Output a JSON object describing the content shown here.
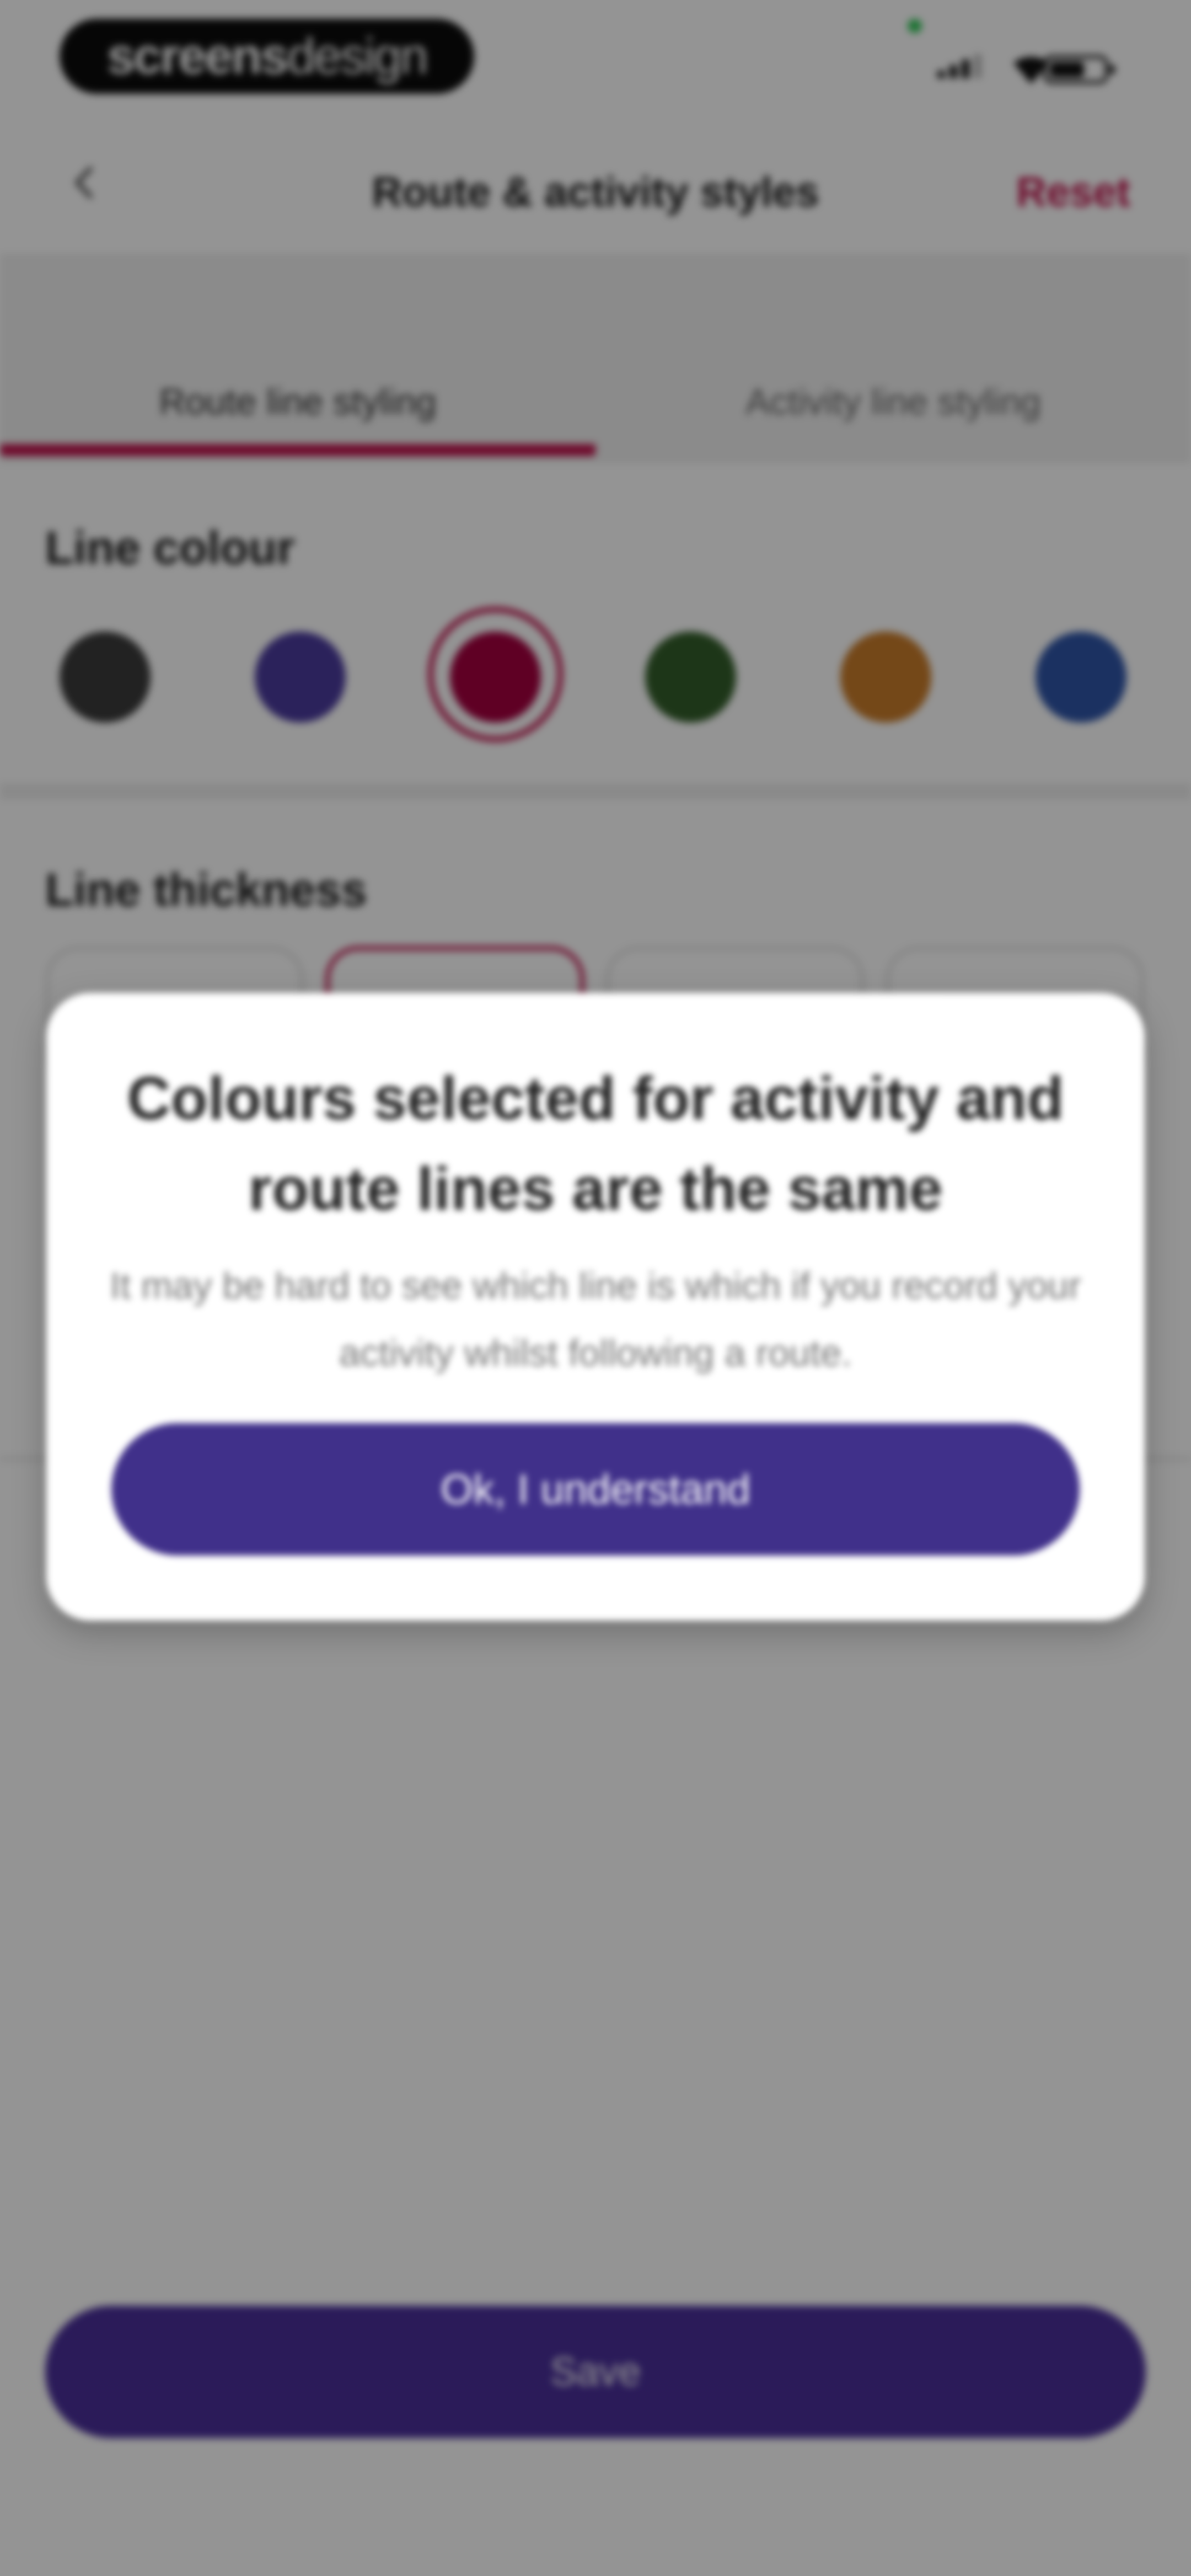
{
  "status_bar": {
    "logo_bold": "screens",
    "logo_light": "design"
  },
  "header": {
    "back_icon": "chevron-left-icon",
    "title": "Route & activity styles",
    "reset_label": "Reset"
  },
  "tabs": [
    {
      "label": "Route line styling",
      "active": true
    },
    {
      "label": "Activity line styling",
      "active": false
    }
  ],
  "line_colour": {
    "title": "Line colour",
    "swatches": [
      "#3b3b3b",
      "#4b3b9e",
      "#a4003f",
      "#335e2a",
      "#c97c2a",
      "#2f55a8"
    ],
    "selected_swatch": "#a4003f"
  },
  "line_thickness": {
    "title": "Line thickness",
    "selected_option": 2
  },
  "dialog": {
    "title": "Colours selected for activity and route lines are the same",
    "body": "It may be hard to see which line is which if you record your activity whilst following a route.",
    "button_label": "Ok, I understand"
  },
  "footer": {
    "save_label": "Save"
  },
  "colors": {
    "accent": "#c0154e",
    "primary_button": "#40308a"
  }
}
